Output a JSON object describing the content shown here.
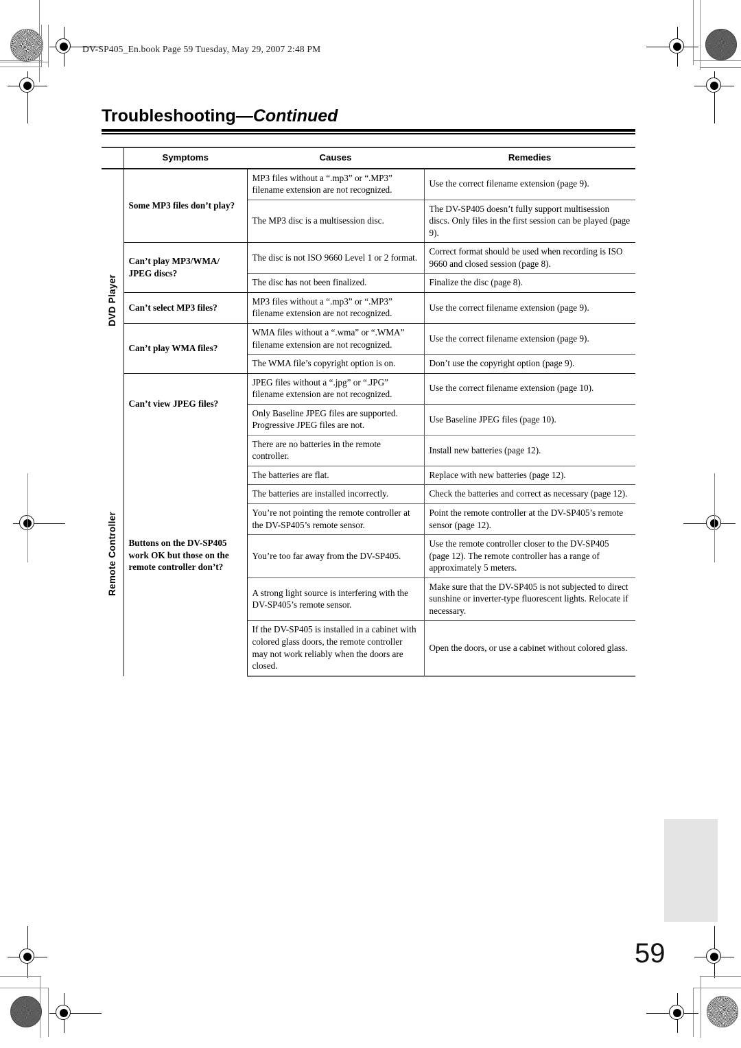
{
  "document": {
    "book_header": "DV-SP405_En.book  Page 59  Tuesday, May 29, 2007  2:48 PM",
    "title_main": "Troubleshooting",
    "title_continued": "—Continued",
    "page_number": "59",
    "tab_marker_color": "#e4e4e4"
  },
  "table": {
    "headers": {
      "side": "",
      "symptoms": "Symptoms",
      "causes": "Causes",
      "remedies": "Remedies"
    },
    "sections": [
      {
        "label": "DVD Player",
        "rows": [
          {
            "symptom": "Some MP3 files don’t play?",
            "symptom_rowspan": 2,
            "cause": "MP3 files without a “.mp3” or “.MP3” filename extension are not recognized.",
            "remedy": "Use the correct filename extension (page 9)."
          },
          {
            "cause": "The MP3 disc is a multisession disc.",
            "remedy": "The DV-SP405 doesn’t fully support multisession discs. Only files in the first session can be played (page 9)."
          },
          {
            "symptom": "Can’t play MP3/WMA/ JPEG discs?",
            "symptom_rowspan": 2,
            "cause": "The disc is not ISO 9660 Level 1 or 2 format.",
            "remedy": "Correct format should be used when recording is ISO 9660 and closed session (page 8)."
          },
          {
            "cause": "The disc has not been finalized.",
            "remedy": "Finalize the disc (page 8)."
          },
          {
            "symptom": "Can’t select MP3 files?",
            "symptom_rowspan": 1,
            "cause": "MP3 files without a “.mp3” or “.MP3” filename extension are not recognized.",
            "remedy": "Use the correct filename extension (page 9)."
          },
          {
            "symptom": "Can’t play WMA files?",
            "symptom_rowspan": 2,
            "cause": "WMA files without a “.wma” or “.WMA” filename extension are not recognized.",
            "remedy": "Use the correct filename extension (page 9)."
          },
          {
            "cause": "The WMA file’s copyright option is on.",
            "remedy": "Don’t use the copyright option (page 9)."
          },
          {
            "symptom": "Can’t view JPEG files?",
            "symptom_rowspan": 2,
            "cause": "JPEG files without a “.jpg” or “.JPG” filename extension are not recognized.",
            "remedy": "Use the correct filename extension (page 10)."
          },
          {
            "cause": "Only Baseline JPEG files are supported. Progressive JPEG files are not.",
            "remedy": "Use Baseline JPEG files (page 10)."
          }
        ]
      },
      {
        "label": "Remote Controller",
        "rows": [
          {
            "symptom": "Buttons on the DV-SP405 work OK but those on the remote controller don’t?",
            "symptom_rowspan": 6,
            "cause": "There are no batteries in the remote controller.",
            "remedy": "Install new batteries (page 12)."
          },
          {
            "cause": "The batteries are flat.",
            "remedy": "Replace with new batteries (page 12)."
          },
          {
            "cause": "The batteries are installed incorrectly.",
            "remedy": "Check the batteries and correct as necessary (page 12)."
          },
          {
            "cause": "You’re not pointing the remote controller at the DV-SP405’s remote sensor.",
            "remedy": "Point the remote controller at the DV-SP405’s remote sensor (page 12)."
          },
          {
            "cause": "You’re too far away from the DV-SP405.",
            "remedy": "Use the remote controller closer to the DV-SP405 (page 12). The remote controller has a range of approximately 5 meters."
          },
          {
            "cause": "A strong light source is interfering with the DV-SP405’s remote sensor.",
            "remedy": "Make sure that the DV-SP405 is not subjected to direct sunshine or inverter-type fluorescent lights. Relocate if necessary."
          },
          {
            "cause": "If the DV-SP405 is installed in a cabinet with colored glass doors, the remote controller may not work reliably when the doors are closed.",
            "remedy": "Open the doors, or use a cabinet without colored glass."
          }
        ]
      }
    ]
  }
}
